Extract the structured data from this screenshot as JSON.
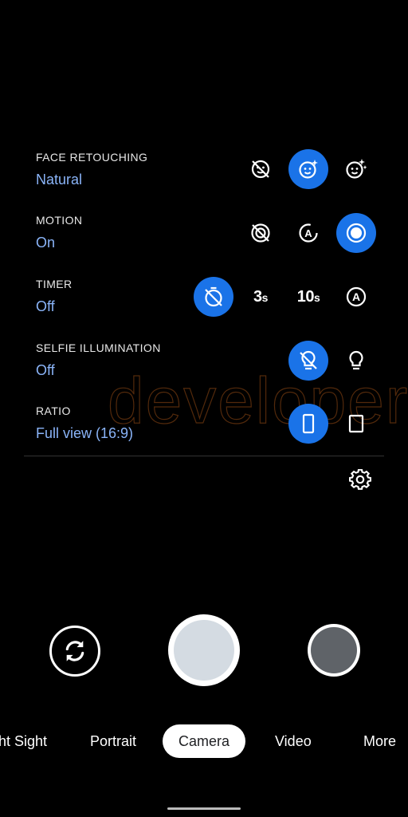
{
  "settings": [
    {
      "label": "FACE RETOUCHING",
      "value": "Natural"
    },
    {
      "label": "MOTION",
      "value": "On"
    },
    {
      "label": "TIMER",
      "value": "Off"
    },
    {
      "label": "SELFIE ILLUMINATION",
      "value": "Off"
    },
    {
      "label": "RATIO",
      "value": "Full view (16:9)"
    }
  ],
  "timer_options": {
    "three": "3",
    "three_unit": "s",
    "ten": "10",
    "ten_unit": "s"
  },
  "watermark": "developers",
  "modes": [
    "ht Sight",
    "Portrait",
    "Camera",
    "Video",
    "More"
  ],
  "active_mode": "Camera",
  "colors": {
    "accent": "#1a73e8",
    "value_text": "#8ab4f8",
    "background": "#000000",
    "shutter_inner": "#d4dbe2",
    "thumbnail": "#5f6368"
  },
  "icons": {
    "face_retouching": [
      "face-retouch-off-icon",
      "face-retouch-natural-icon",
      "face-retouch-smooth-icon"
    ],
    "motion": [
      "motion-off-icon",
      "motion-auto-icon",
      "motion-on-icon"
    ],
    "timer": [
      "timer-off-icon",
      "timer-3s",
      "timer-10s",
      "timer-auto-icon"
    ],
    "selfie_illumination": [
      "illumination-off-icon",
      "illumination-on-icon"
    ],
    "ratio": [
      "ratio-full-icon",
      "ratio-4-3-icon"
    ],
    "other": [
      "settings-gear-icon",
      "switch-camera-icon"
    ]
  }
}
